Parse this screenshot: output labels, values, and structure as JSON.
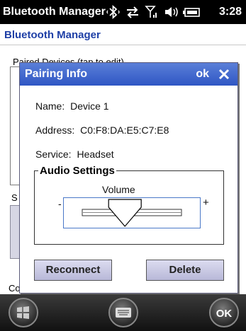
{
  "status_bar": {
    "title": "Bluetooth Manager",
    "time": "3:28",
    "icons": [
      "bluetooth-icon",
      "sync-arrows-icon",
      "signal-icon",
      "speaker-icon",
      "battery-icon"
    ]
  },
  "app": {
    "title": "Bluetooth Manager",
    "paired_label": "Paired Devices (tap to edit)",
    "partial_s": "S",
    "partial_co": "Co"
  },
  "dialog": {
    "title": "Pairing Info",
    "ok_label": "ok",
    "name_label": "Name:",
    "name_value": "Device 1",
    "address_label": "Address:",
    "address_value": "C0:F8:DA:E5:C7:E8",
    "service_label": "Service:",
    "service_value": "Headset",
    "audio_settings_label": "Audio Settings",
    "volume_label": "Volume",
    "minus_label": "-",
    "plus_label": "+",
    "volume_level": 0.43,
    "reconnect_label": "Reconnect",
    "delete_label": "Delete"
  },
  "bottom_bar": {
    "ok_label": "OK",
    "icons": [
      "windows-start-icon",
      "keyboard-icon"
    ]
  },
  "colors": {
    "titlebar_blue": "#2f56c4",
    "app_title_blue": "#1e3fa6",
    "slider_border": "#4a78c8"
  }
}
